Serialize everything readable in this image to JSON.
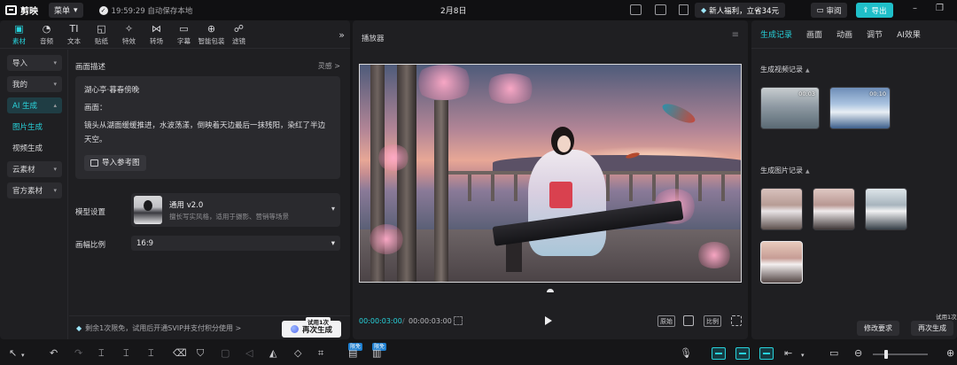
{
  "titlebar": {
    "app_name": "剪映",
    "menu_label": "菜单",
    "save_status": "19:59:29 自动保存本地",
    "doc_title": "2月8日",
    "promo_label": "新人福利，立省34元",
    "review_label": "审阅",
    "export_label": "导出"
  },
  "tool_tabs": [
    {
      "label": "素材",
      "icon": "media-icon",
      "glyph": "▣"
    },
    {
      "label": "音频",
      "icon": "audio-icon",
      "glyph": "◔"
    },
    {
      "label": "文本",
      "icon": "text-icon",
      "glyph": "TI"
    },
    {
      "label": "贴纸",
      "icon": "sticker-icon",
      "glyph": "◱"
    },
    {
      "label": "特效",
      "icon": "effects-icon",
      "glyph": "✧"
    },
    {
      "label": "转场",
      "icon": "transition-icon",
      "glyph": "⋈"
    },
    {
      "label": "字幕",
      "icon": "subtitle-icon",
      "glyph": "▭"
    },
    {
      "label": "智能包装",
      "icon": "smart-pack-icon",
      "glyph": "⊕"
    },
    {
      "label": "滤镜",
      "icon": "filter-icon",
      "glyph": "☍"
    }
  ],
  "tab_more": "»",
  "categories": [
    {
      "label": "导入"
    },
    {
      "label": "我的"
    },
    {
      "label": "AI 生成"
    }
  ],
  "ai_sub": [
    {
      "label": "图片生成"
    },
    {
      "label": "视频生成"
    }
  ],
  "categories_more": [
    {
      "label": "云素材"
    },
    {
      "label": "官方素材"
    }
  ],
  "form": {
    "header_label": "画面描述",
    "inspire_label": "灵感 >",
    "desc_lines": [
      "湖心亭·暮春傍晚",
      "画面：",
      "镜头从湖面缓缓推进，水波荡漾，倒映着天边最后一抹残阳，染红了半边天空。"
    ],
    "ref_button": "导入参考图",
    "model_label": "模型设置",
    "model_name": "通用 v2.0",
    "model_desc": "擅长写实风格，适用于摄影、营销等场景",
    "ratio_label": "画幅比例",
    "ratio_value": "16:9"
  },
  "quota": {
    "text": "剩余1次限免，试用后开通SVIP并支付积分使用 >",
    "generate_button": "再次生成",
    "trial_tag": "试用1次"
  },
  "player": {
    "title": "播放器",
    "time_current": "00:00:03:00",
    "time_sep": "/",
    "time_total": "00:00:03:00",
    "btn_original": "原始",
    "btn_ratio": "比例"
  },
  "right": {
    "tabs": [
      "生成记录",
      "画面",
      "动画",
      "调节",
      "AI效果"
    ],
    "video_section": "生成视频记录",
    "image_section": "生成图片记录",
    "video_thumbs": [
      {
        "time": "00:03"
      },
      {
        "time": "00:10"
      }
    ],
    "modify_button": "修改要求",
    "regen_button": "再次生成",
    "trial_tag": "试用1次"
  },
  "bottom": {
    "badge_free": "限免"
  },
  "colors": {
    "accent": "#27d3dc",
    "export_button": "#1fbfc9",
    "badge": "#1e7fd0"
  }
}
